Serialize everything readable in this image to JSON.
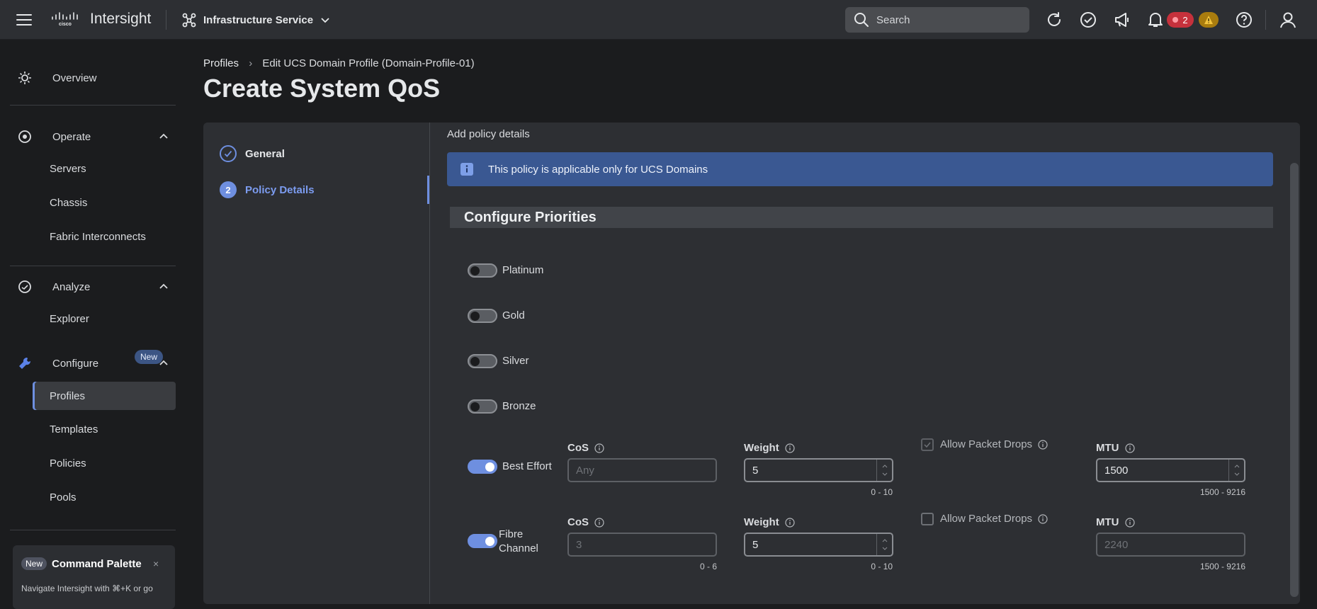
{
  "topbar": {
    "brand": "Intersight",
    "service": "Infrastructure Service",
    "search_placeholder": "Search",
    "alert_count": "2",
    "icons": [
      "menu-icon",
      "cisco-logo",
      "service-icon",
      "chevron-down-icon",
      "search-icon",
      "refresh-icon",
      "check-circle-icon",
      "megaphone-icon",
      "bell-icon",
      "warning-icon",
      "help-icon",
      "user-icon"
    ]
  },
  "sidebar": {
    "overview": "Overview",
    "operate": {
      "label": "Operate",
      "items": [
        "Servers",
        "Chassis",
        "Fabric Interconnects"
      ]
    },
    "analyze": {
      "label": "Analyze",
      "items": [
        "Explorer"
      ],
      "new_badge": "New"
    },
    "configure": {
      "label": "Configure",
      "items": [
        "Profiles",
        "Templates",
        "Policies",
        "Pools"
      ],
      "active": "Profiles"
    },
    "command_palette": {
      "badge": "New",
      "title": "Command Palette",
      "close": "×",
      "text": "Navigate Intersight with ⌘+K or go"
    }
  },
  "breadcrumb": {
    "root": "Profiles",
    "separator": "›",
    "current": "Edit UCS Domain Profile (Domain-Profile-01)"
  },
  "page_title": "Create System QoS",
  "wizard": {
    "steps": [
      {
        "num": "",
        "label": "General",
        "state": "done"
      },
      {
        "num": "2",
        "label": "Policy Details",
        "state": "current"
      }
    ]
  },
  "main": {
    "subtitle": "Add policy details",
    "info": "This policy is applicable only for UCS Domains",
    "section": "Configure Priorities",
    "priorities": [
      {
        "name": "Platinum",
        "enabled": false
      },
      {
        "name": "Gold",
        "enabled": false
      },
      {
        "name": "Silver",
        "enabled": false
      },
      {
        "name": "Bronze",
        "enabled": false
      }
    ],
    "best_effort": {
      "name": "Best Effort",
      "enabled": true,
      "cos_label": "CoS",
      "cos_value": "Any",
      "weight_label": "Weight",
      "weight_value": "5",
      "weight_range": "0 - 10",
      "drops_label": "Allow Packet Drops",
      "drops_checked": true,
      "mtu_label": "MTU",
      "mtu_value": "1500",
      "mtu_range": "1500 - 9216"
    },
    "fibre_channel": {
      "name_line1": "Fibre",
      "name_line2": "Channel",
      "enabled": true,
      "cos_label": "CoS",
      "cos_value": "3",
      "cos_range": "0 - 6",
      "weight_label": "Weight",
      "weight_value": "5",
      "weight_range": "0 - 10",
      "drops_label": "Allow Packet Drops",
      "drops_checked": false,
      "mtu_label": "MTU",
      "mtu_value": "2240",
      "mtu_range": "1500 - 9216"
    }
  },
  "colors": {
    "accent": "#6e8fe0",
    "info_bg": "#3a5892",
    "alert": "#c6313c",
    "warning": "#a97c0e"
  }
}
